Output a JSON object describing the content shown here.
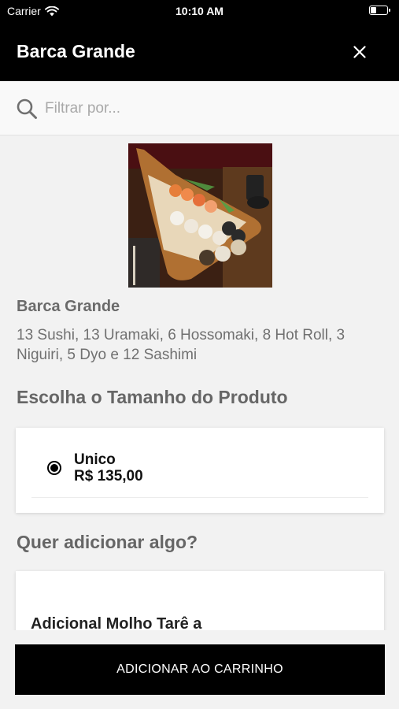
{
  "status_bar": {
    "carrier": "Carrier",
    "time": "10:10 AM"
  },
  "header": {
    "title": "Barca Grande",
    "close_icon": "close-icon"
  },
  "search": {
    "placeholder": "Filtrar por...",
    "value": "",
    "icon": "search-icon"
  },
  "product": {
    "image_alt": "sushi-boat-photo",
    "name": "Barca Grande",
    "description": "13 Sushi, 13 Uramaki, 6 Hossomaki, 8 Hot Roll, 3 Niguiri, 5 Dyo e 12 Sashimi"
  },
  "size_section": {
    "title": "Escolha o Tamanho do Produto",
    "options": [
      {
        "name": "Unico",
        "price": "R$ 135,00",
        "selected": true
      }
    ]
  },
  "addon_section": {
    "title": "Quer adicionar algo?",
    "items": [
      {
        "label": "Adicional Molho Tarê a"
      }
    ]
  },
  "footer": {
    "cart_button_label": "ADICIONAR AO CARRINHO"
  },
  "colors": {
    "header_bg": "#000000",
    "button_bg": "#000000",
    "page_bg": "#f2f2f2"
  }
}
